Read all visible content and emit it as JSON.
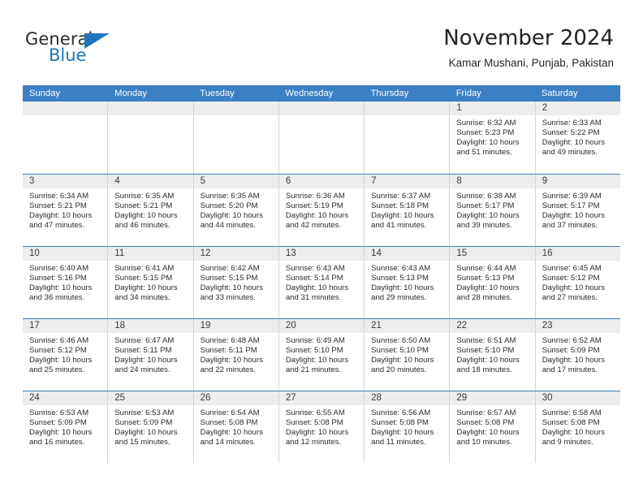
{
  "brand": {
    "name_part1": "General",
    "name_part2": "Blue",
    "accent_color": "#1f76bc"
  },
  "header": {
    "title": "November 2024",
    "subtitle": "Kamar Mushani, Punjab, Pakistan"
  },
  "calendar": {
    "header_color": "#3b7fc4",
    "daynum_bg": "#ededed",
    "weekdays": [
      "Sunday",
      "Monday",
      "Tuesday",
      "Wednesday",
      "Thursday",
      "Friday",
      "Saturday"
    ],
    "weeks": [
      [
        {
          "day": "",
          "empty": true
        },
        {
          "day": "",
          "empty": true
        },
        {
          "day": "",
          "empty": true
        },
        {
          "day": "",
          "empty": true
        },
        {
          "day": "",
          "empty": true
        },
        {
          "day": "1",
          "sunrise": "Sunrise: 6:32 AM",
          "sunset": "Sunset: 5:23 PM",
          "daylight1": "Daylight: 10 hours",
          "daylight2": "and 51 minutes."
        },
        {
          "day": "2",
          "sunrise": "Sunrise: 6:33 AM",
          "sunset": "Sunset: 5:22 PM",
          "daylight1": "Daylight: 10 hours",
          "daylight2": "and 49 minutes."
        }
      ],
      [
        {
          "day": "3",
          "sunrise": "Sunrise: 6:34 AM",
          "sunset": "Sunset: 5:21 PM",
          "daylight1": "Daylight: 10 hours",
          "daylight2": "and 47 minutes."
        },
        {
          "day": "4",
          "sunrise": "Sunrise: 6:35 AM",
          "sunset": "Sunset: 5:21 PM",
          "daylight1": "Daylight: 10 hours",
          "daylight2": "and 46 minutes."
        },
        {
          "day": "5",
          "sunrise": "Sunrise: 6:35 AM",
          "sunset": "Sunset: 5:20 PM",
          "daylight1": "Daylight: 10 hours",
          "daylight2": "and 44 minutes."
        },
        {
          "day": "6",
          "sunrise": "Sunrise: 6:36 AM",
          "sunset": "Sunset: 5:19 PM",
          "daylight1": "Daylight: 10 hours",
          "daylight2": "and 42 minutes."
        },
        {
          "day": "7",
          "sunrise": "Sunrise: 6:37 AM",
          "sunset": "Sunset: 5:18 PM",
          "daylight1": "Daylight: 10 hours",
          "daylight2": "and 41 minutes."
        },
        {
          "day": "8",
          "sunrise": "Sunrise: 6:38 AM",
          "sunset": "Sunset: 5:17 PM",
          "daylight1": "Daylight: 10 hours",
          "daylight2": "and 39 minutes."
        },
        {
          "day": "9",
          "sunrise": "Sunrise: 6:39 AM",
          "sunset": "Sunset: 5:17 PM",
          "daylight1": "Daylight: 10 hours",
          "daylight2": "and 37 minutes."
        }
      ],
      [
        {
          "day": "10",
          "sunrise": "Sunrise: 6:40 AM",
          "sunset": "Sunset: 5:16 PM",
          "daylight1": "Daylight: 10 hours",
          "daylight2": "and 36 minutes."
        },
        {
          "day": "11",
          "sunrise": "Sunrise: 6:41 AM",
          "sunset": "Sunset: 5:15 PM",
          "daylight1": "Daylight: 10 hours",
          "daylight2": "and 34 minutes."
        },
        {
          "day": "12",
          "sunrise": "Sunrise: 6:42 AM",
          "sunset": "Sunset: 5:15 PM",
          "daylight1": "Daylight: 10 hours",
          "daylight2": "and 33 minutes."
        },
        {
          "day": "13",
          "sunrise": "Sunrise: 6:43 AM",
          "sunset": "Sunset: 5:14 PM",
          "daylight1": "Daylight: 10 hours",
          "daylight2": "and 31 minutes."
        },
        {
          "day": "14",
          "sunrise": "Sunrise: 6:43 AM",
          "sunset": "Sunset: 5:13 PM",
          "daylight1": "Daylight: 10 hours",
          "daylight2": "and 29 minutes."
        },
        {
          "day": "15",
          "sunrise": "Sunrise: 6:44 AM",
          "sunset": "Sunset: 5:13 PM",
          "daylight1": "Daylight: 10 hours",
          "daylight2": "and 28 minutes."
        },
        {
          "day": "16",
          "sunrise": "Sunrise: 6:45 AM",
          "sunset": "Sunset: 5:12 PM",
          "daylight1": "Daylight: 10 hours",
          "daylight2": "and 27 minutes."
        }
      ],
      [
        {
          "day": "17",
          "sunrise": "Sunrise: 6:46 AM",
          "sunset": "Sunset: 5:12 PM",
          "daylight1": "Daylight: 10 hours",
          "daylight2": "and 25 minutes."
        },
        {
          "day": "18",
          "sunrise": "Sunrise: 6:47 AM",
          "sunset": "Sunset: 5:11 PM",
          "daylight1": "Daylight: 10 hours",
          "daylight2": "and 24 minutes."
        },
        {
          "day": "19",
          "sunrise": "Sunrise: 6:48 AM",
          "sunset": "Sunset: 5:11 PM",
          "daylight1": "Daylight: 10 hours",
          "daylight2": "and 22 minutes."
        },
        {
          "day": "20",
          "sunrise": "Sunrise: 6:49 AM",
          "sunset": "Sunset: 5:10 PM",
          "daylight1": "Daylight: 10 hours",
          "daylight2": "and 21 minutes."
        },
        {
          "day": "21",
          "sunrise": "Sunrise: 6:50 AM",
          "sunset": "Sunset: 5:10 PM",
          "daylight1": "Daylight: 10 hours",
          "daylight2": "and 20 minutes."
        },
        {
          "day": "22",
          "sunrise": "Sunrise: 6:51 AM",
          "sunset": "Sunset: 5:10 PM",
          "daylight1": "Daylight: 10 hours",
          "daylight2": "and 18 minutes."
        },
        {
          "day": "23",
          "sunrise": "Sunrise: 6:52 AM",
          "sunset": "Sunset: 5:09 PM",
          "daylight1": "Daylight: 10 hours",
          "daylight2": "and 17 minutes."
        }
      ],
      [
        {
          "day": "24",
          "sunrise": "Sunrise: 6:53 AM",
          "sunset": "Sunset: 5:09 PM",
          "daylight1": "Daylight: 10 hours",
          "daylight2": "and 16 minutes."
        },
        {
          "day": "25",
          "sunrise": "Sunrise: 6:53 AM",
          "sunset": "Sunset: 5:09 PM",
          "daylight1": "Daylight: 10 hours",
          "daylight2": "and 15 minutes."
        },
        {
          "day": "26",
          "sunrise": "Sunrise: 6:54 AM",
          "sunset": "Sunset: 5:08 PM",
          "daylight1": "Daylight: 10 hours",
          "daylight2": "and 14 minutes."
        },
        {
          "day": "27",
          "sunrise": "Sunrise: 6:55 AM",
          "sunset": "Sunset: 5:08 PM",
          "daylight1": "Daylight: 10 hours",
          "daylight2": "and 12 minutes."
        },
        {
          "day": "28",
          "sunrise": "Sunrise: 6:56 AM",
          "sunset": "Sunset: 5:08 PM",
          "daylight1": "Daylight: 10 hours",
          "daylight2": "and 11 minutes."
        },
        {
          "day": "29",
          "sunrise": "Sunrise: 6:57 AM",
          "sunset": "Sunset: 5:08 PM",
          "daylight1": "Daylight: 10 hours",
          "daylight2": "and 10 minutes."
        },
        {
          "day": "30",
          "sunrise": "Sunrise: 6:58 AM",
          "sunset": "Sunset: 5:08 PM",
          "daylight1": "Daylight: 10 hours",
          "daylight2": "and 9 minutes."
        }
      ]
    ]
  }
}
